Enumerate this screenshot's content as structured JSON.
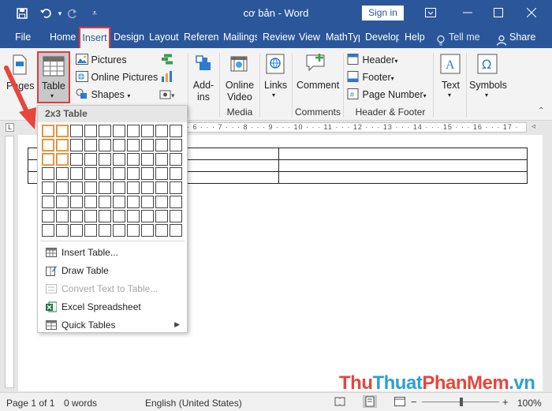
{
  "window": {
    "title": "cơ bản  -  Word",
    "sign_in": "Sign in"
  },
  "tabs": [
    "File",
    "Home",
    "Insert",
    "Design",
    "Layout",
    "Referenc",
    "Mailings",
    "Review",
    "View",
    "MathTyp",
    "Develop",
    "Help"
  ],
  "active_tab": "Insert",
  "tell_me": "Tell me",
  "share": "Share",
  "ribbon": {
    "pages": "Pages",
    "table": "Table",
    "pictures": "Pictures",
    "online_pictures": "Online Pictures",
    "shapes": "Shapes",
    "addins": "Add-ins",
    "online_video": "Online Video",
    "media_group": "Media",
    "links": "Links",
    "comment": "Comment",
    "comments_group": "Comments",
    "header": "Header",
    "footer": "Footer",
    "page_number": "Page Number",
    "header_footer_group": "Header & Footer",
    "text": "Text",
    "symbols": "Symbols"
  },
  "table_menu": {
    "header": "2x3 Table",
    "grid_cols": 10,
    "grid_rows": 8,
    "selected_cols": 2,
    "selected_rows": 3,
    "items": [
      {
        "label": "Insert Table...",
        "disabled": false
      },
      {
        "label": "Draw Table",
        "disabled": false
      },
      {
        "label": "Convert Text to Table...",
        "disabled": true
      },
      {
        "label": "Excel Spreadsheet",
        "disabled": false
      },
      {
        "label": "Quick Tables",
        "disabled": false
      }
    ]
  },
  "ruler_text": "· 6 · · · 7 · · · 8 · · · 9 · · · 10 · · · 11 · · · 12 · · · 13 · · · 14 · · · 15 · · · 16 · · · 17 ·",
  "status": {
    "page": "Page 1 of 1",
    "words": "0 words",
    "language": "English (United States)",
    "zoom": "100%"
  },
  "watermark": {
    "part1": "Thu",
    "part2": "Thuat",
    "part3": "PhanMem",
    "part4": ".vn"
  },
  "colors": {
    "title_bar": "#2b579a",
    "highlight_border": "#e03b3b",
    "grid_highlight": "#e6842a"
  }
}
